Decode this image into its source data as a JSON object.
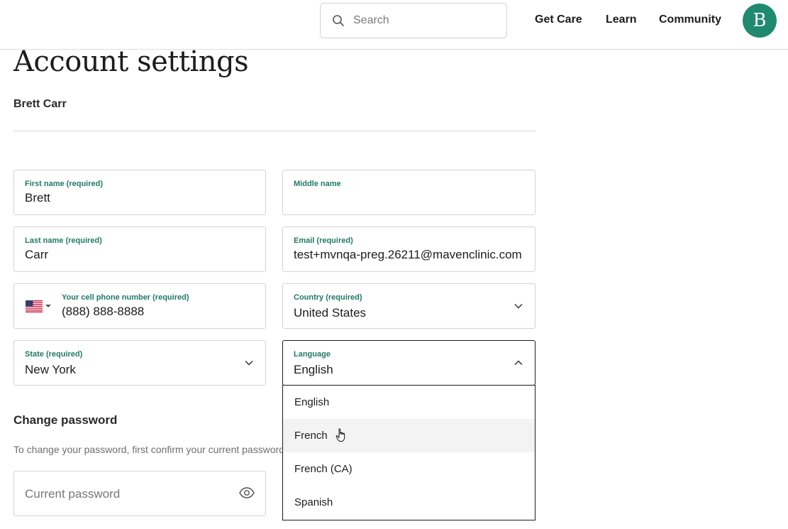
{
  "header": {
    "search": {
      "placeholder": "Search"
    },
    "nav": [
      {
        "label": "Get Care"
      },
      {
        "label": "Learn"
      },
      {
        "label": "Community"
      }
    ],
    "avatar_initial": "B",
    "avatar_color": "#1f8a70"
  },
  "page": {
    "title": "Account settings",
    "user_name": "Brett Carr"
  },
  "form": {
    "first_name": {
      "label": "First name (required)",
      "value": "Brett"
    },
    "middle_name": {
      "label": "Middle name",
      "value": ""
    },
    "last_name": {
      "label": "Last name (required)",
      "value": "Carr"
    },
    "email": {
      "label": "Email (required)",
      "value": "test+mvnqa-preg.26211@mavenclinic.com"
    },
    "phone": {
      "label": "Your cell phone number (required)",
      "value": "(888) 888-8888",
      "country_flag": "us-flag-icon"
    },
    "country": {
      "label": "Country (required)",
      "value": "United States"
    },
    "state": {
      "label": "State (required)",
      "value": "New York"
    },
    "language": {
      "label": "Language",
      "value": "English",
      "options": [
        "English",
        "French",
        "French (CA)",
        "Spanish"
      ],
      "hovered": "French"
    }
  },
  "password": {
    "section_title": "Change password",
    "hint": "To change your password, first confirm your current password.",
    "current_placeholder": "Current password"
  },
  "colors": {
    "accent": "#1f7a63",
    "border": "#d3d3d3"
  }
}
